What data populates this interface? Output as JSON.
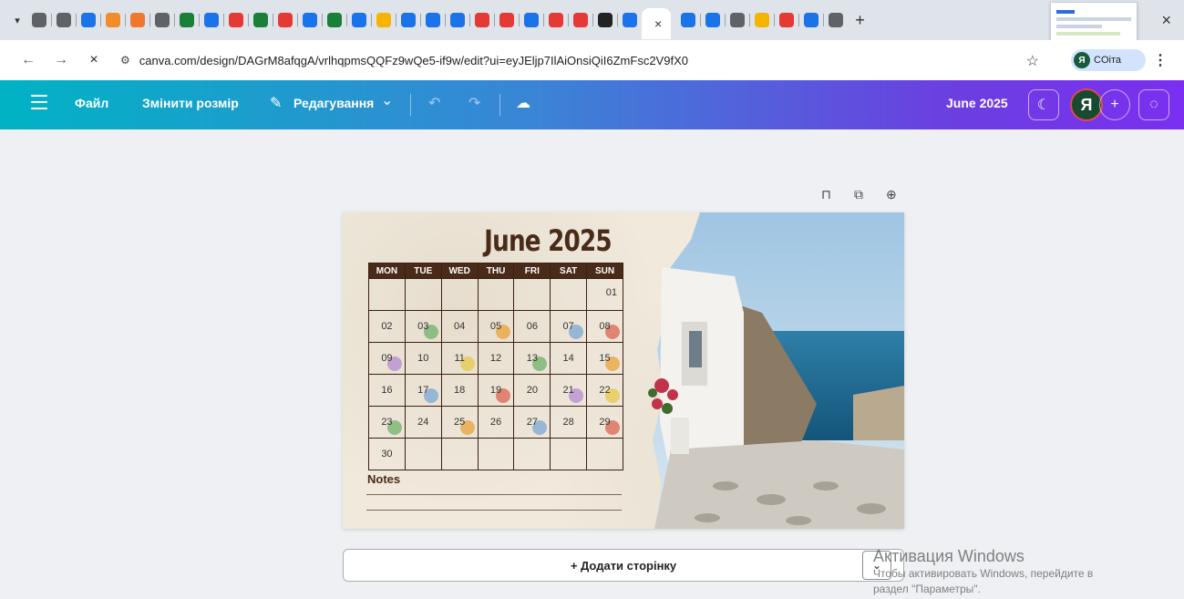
{
  "tabs": {
    "active_close": "×",
    "new_tab": "+",
    "favicon_colors": [
      "#5f6368",
      "#5f6368",
      "#1a73e8",
      "#f28b2a",
      "#f0782a",
      "#5f6368",
      "#188038",
      "#1a73e8",
      "#e53935",
      "#188038",
      "#e53935",
      "#1a73e8",
      "#188038",
      "#1a73e8",
      "#f4b400",
      "#1a73e8",
      "#1a73e8",
      "#1a73e8",
      "#e53935",
      "#e53935",
      "#1a73e8",
      "#e53935",
      "#e53935",
      "#222",
      "#1a73e8"
    ],
    "after_colors": [
      "#1a73e8",
      "#1a73e8",
      "#5f6368",
      "#f4b400",
      "#e53935",
      "#1a73e8",
      "#5f6368"
    ],
    "window_close": "×"
  },
  "address_bar": {
    "back": "←",
    "forward": "→",
    "stop": "×",
    "site_icon": "⚙",
    "url": "canva.com/design/DAGrM8afqgA/vrlhqpmsQQFz9wQe5-if9w/edit?ui=eyJEljp7IlAiOnsiQiI6ZmFsc2V9fX0",
    "bookmark_star": "☆",
    "profile_initial": "Я",
    "profile_name": "COіта",
    "menu": "⋮"
  },
  "toolbar": {
    "menu_icon": "hamburger-icon",
    "file": "Файл",
    "resize": "Змінити розмір",
    "edit_icon": "✎",
    "edit": "Редагування",
    "edit_chevron": "⌄",
    "undo": "↶",
    "redo": "↷",
    "sync_icon": "☁",
    "design_title": "June 2025",
    "timer_icon": "☾",
    "user_initial": "Я",
    "add": "+",
    "comment_icon": "◌"
  },
  "page_tools": {
    "lock": "⊓",
    "duplicate": "⧉",
    "add": "⊕"
  },
  "calendar": {
    "title": "June 2025",
    "weekdays": [
      "MON",
      "TUE",
      "WED",
      "THU",
      "FRI",
      "SAT",
      "SUN"
    ],
    "weeks": [
      [
        "",
        "",
        "",
        "",
        "",
        "",
        "01"
      ],
      [
        "02",
        "03",
        "04",
        "05",
        "06",
        "07",
        "08"
      ],
      [
        "09",
        "10",
        "11",
        "12",
        "13",
        "14",
        "15"
      ],
      [
        "16",
        "17",
        "18",
        "19",
        "20",
        "21",
        "22"
      ],
      [
        "23",
        "24",
        "25",
        "26",
        "27",
        "28",
        "29"
      ],
      [
        "30",
        "",
        "",
        "",
        "",
        "",
        ""
      ]
    ],
    "notes_label": "Notes"
  },
  "add_page": {
    "label": "+ Додати сторінку",
    "chevron": "⌄"
  },
  "activation": {
    "title": "Активация Windows",
    "line1": "Чтобы активировать Windows, перейдите в",
    "line2": "раздел \"Параметры\"."
  }
}
